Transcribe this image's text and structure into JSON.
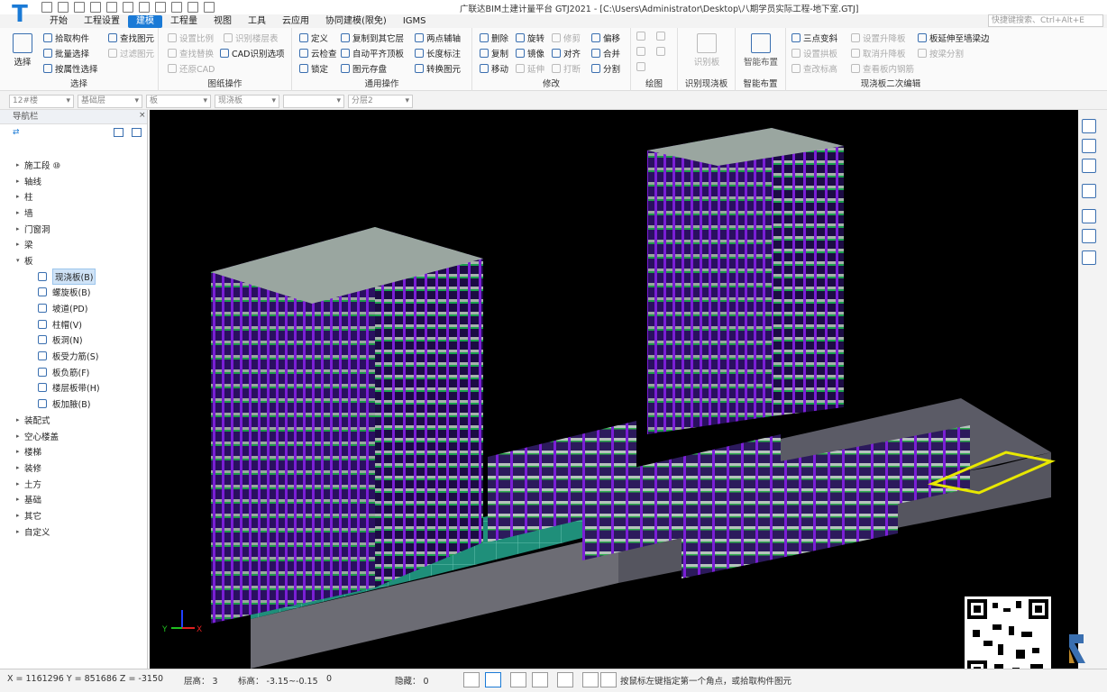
{
  "app": {
    "logo": "T",
    "window_title": "广联达BIM土建计量平台 GTJ2021 - [C:\\Users\\Administrator\\Desktop\\八期学员实际工程-地下室.GTJ]",
    "quick_search_placeholder": "快捷键搜索、Ctrl+Alt+E"
  },
  "menu": [
    "开始",
    "工程设置",
    "建模",
    "工程量",
    "视图",
    "工具",
    "云应用",
    "协同建模(限免)",
    "IGMS"
  ],
  "menu_active": "建模",
  "ribbon": {
    "select": {
      "label": "选择",
      "big": "选择",
      "items": [
        "拾取构件",
        "批量选择",
        "按属性选择",
        "查找图元",
        "过滤图元"
      ]
    },
    "drawing_ops": {
      "label": "图纸操作",
      "items": [
        "设置比例",
        "识别楼层表",
        "查找替换",
        "CAD识别选项",
        "还原CAD"
      ]
    },
    "general_ops": {
      "label": "通用操作",
      "items": [
        "定义",
        "复制到其它层",
        "两点辅轴",
        "云检查",
        "自动平齐顶板",
        "长度标注",
        "锁定",
        "图元存盘",
        "转换图元"
      ]
    },
    "modify": {
      "label": "修改",
      "items": [
        "删除",
        "旋转",
        "修剪",
        "偏移",
        "复制",
        "镜像",
        "对齐",
        "合并",
        "移动",
        "延伸",
        "打断",
        "分割"
      ]
    },
    "draw": {
      "label": "绘图"
    },
    "recognize": {
      "label": "识别现浇板",
      "big": "识别板"
    },
    "smart": {
      "label": "智能布置",
      "big": "智能布置"
    },
    "slab_edit": {
      "label": "现浇板二次编辑",
      "items": [
        "三点变斜",
        "设置升降板",
        "板延伸至墙梁边",
        "设置拱板",
        "取消升降板",
        "按梁分割",
        "查改标高",
        "查看板内钢筋"
      ]
    }
  },
  "filters": [
    "12#楼",
    "基础层",
    "板",
    "现浇板",
    "",
    "分层2"
  ],
  "nav": {
    "title": "导航栏",
    "tree": [
      {
        "label": "施工段 ⑩",
        "sub": false,
        "open": false
      },
      {
        "label": "轴线",
        "sub": false,
        "open": false
      },
      {
        "label": "柱",
        "sub": false,
        "open": false
      },
      {
        "label": "墙",
        "sub": false,
        "open": false
      },
      {
        "label": "门窗洞",
        "sub": false,
        "open": false
      },
      {
        "label": "梁",
        "sub": false,
        "open": false
      },
      {
        "label": "板",
        "sub": false,
        "open": true
      },
      {
        "label": "现浇板(B)",
        "sub": true,
        "sel": true
      },
      {
        "label": "螺旋板(B)",
        "sub": true
      },
      {
        "label": "坡道(PD)",
        "sub": true
      },
      {
        "label": "柱帽(V)",
        "sub": true
      },
      {
        "label": "板洞(N)",
        "sub": true
      },
      {
        "label": "板受力筋(S)",
        "sub": true
      },
      {
        "label": "板负筋(F)",
        "sub": true
      },
      {
        "label": "楼层板带(H)",
        "sub": true
      },
      {
        "label": "板加腋(B)",
        "sub": true
      },
      {
        "label": "装配式",
        "sub": false
      },
      {
        "label": "空心楼盖",
        "sub": false
      },
      {
        "label": "楼梯",
        "sub": false
      },
      {
        "label": "装修",
        "sub": false
      },
      {
        "label": "土方",
        "sub": false
      },
      {
        "label": "基础",
        "sub": false
      },
      {
        "label": "其它",
        "sub": false
      },
      {
        "label": "自定义",
        "sub": false
      }
    ]
  },
  "status": {
    "coords": "X = 1161296 Y = 851686 Z = -3150",
    "floor_height": "层高： 3",
    "elevation": "标高： -3.15~-0.15",
    "count": "0",
    "hidden": "隐藏： 0",
    "hint": "按鼠标左键指定第一个角点，或拾取构件图元"
  },
  "colors": {
    "accent": "#1a7ad6",
    "structure_purple": "#7a1fd6",
    "slab_teal": "#1f8f7a",
    "highlight": "#e8e800"
  }
}
